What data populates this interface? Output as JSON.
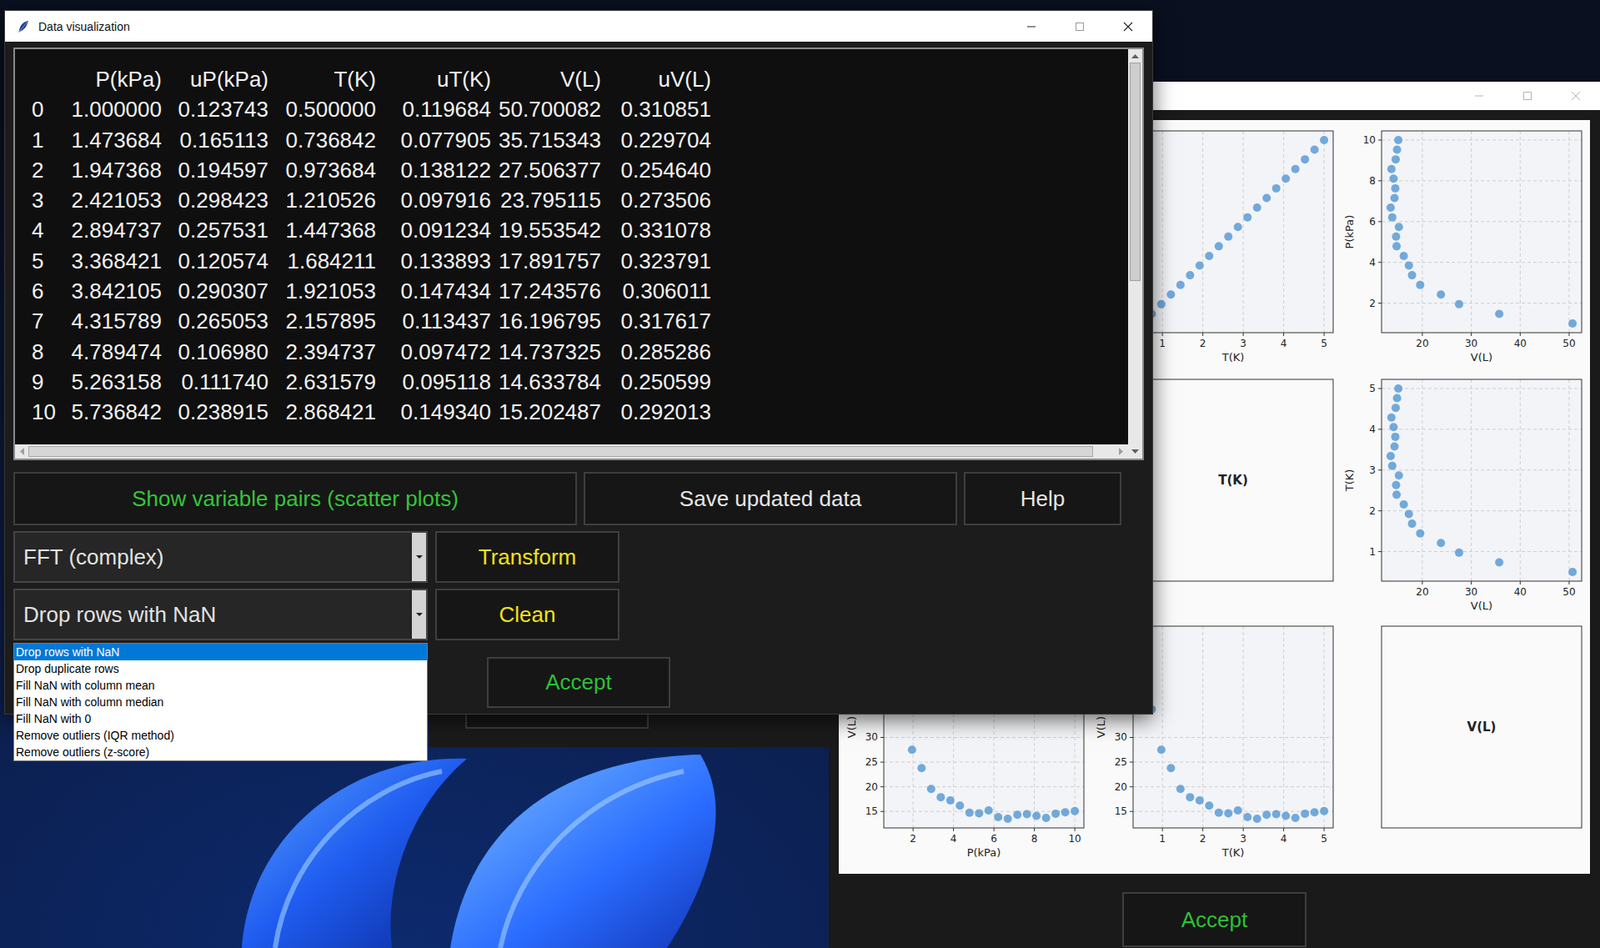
{
  "front_window": {
    "title": "Data visualization",
    "table": {
      "columns": [
        "P(kPa)",
        "uP(kPa)",
        "T(K)",
        "uT(K)",
        "V(L)",
        "uV(L)"
      ],
      "rows": [
        {
          "index": "0",
          "cells": [
            "1.000000",
            "0.123743",
            "0.500000",
            "0.119684",
            "50.700082",
            "0.310851"
          ]
        },
        {
          "index": "1",
          "cells": [
            "1.473684",
            "0.165113",
            "0.736842",
            "0.077905",
            "35.715343",
            "0.229704"
          ]
        },
        {
          "index": "2",
          "cells": [
            "1.947368",
            "0.194597",
            "0.973684",
            "0.138122",
            "27.506377",
            "0.254640"
          ]
        },
        {
          "index": "3",
          "cells": [
            "2.421053",
            "0.298423",
            "1.210526",
            "0.097916",
            "23.795115",
            "0.273506"
          ]
        },
        {
          "index": "4",
          "cells": [
            "2.894737",
            "0.257531",
            "1.447368",
            "0.091234",
            "19.553542",
            "0.331078"
          ]
        },
        {
          "index": "5",
          "cells": [
            "3.368421",
            "0.120574",
            "1.684211",
            "0.133893",
            "17.891757",
            "0.323791"
          ]
        },
        {
          "index": "6",
          "cells": [
            "3.842105",
            "0.290307",
            "1.921053",
            "0.147434",
            "17.243576",
            "0.306011"
          ]
        },
        {
          "index": "7",
          "cells": [
            "4.315789",
            "0.265053",
            "2.157895",
            "0.113437",
            "16.196795",
            "0.317617"
          ]
        },
        {
          "index": "8",
          "cells": [
            "4.789474",
            "0.106980",
            "2.394737",
            "0.097472",
            "14.737325",
            "0.285286"
          ]
        },
        {
          "index": "9",
          "cells": [
            "5.263158",
            "0.111740",
            "2.631579",
            "0.095118",
            "14.633784",
            "0.250599"
          ]
        },
        {
          "index": "10",
          "cells": [
            "5.736842",
            "0.238915",
            "2.868421",
            "0.149340",
            "15.202487",
            "0.292013"
          ]
        }
      ],
      "v_scrollbar": {
        "level": 0.57
      },
      "h_scrollbar": {
        "level": 0.98
      }
    },
    "action_buttons": [
      {
        "label": "Show variable pairs (scatter plots)",
        "color": "#36c43a"
      },
      {
        "label": "Save updated data",
        "color": "#e6e6e6"
      },
      {
        "label": "Help",
        "color": "#e6e6e6"
      }
    ],
    "transform": {
      "value": "FFT (complex)",
      "button": "Transform"
    },
    "clean": {
      "value": "Drop rows with NaN",
      "expanded": true,
      "button": "Clean",
      "options": [
        {
          "label": "Drop rows with NaN",
          "selected": true
        },
        {
          "label": "Drop duplicate rows",
          "selected": false
        },
        {
          "label": "Fill NaN with column mean",
          "selected": false
        },
        {
          "label": "Fill NaN with column median",
          "selected": false
        },
        {
          "label": "Fill NaN with 0",
          "selected": false
        },
        {
          "label": "Remove outliers (IQR method)",
          "selected": false
        },
        {
          "label": "Remove outliers (z-score)",
          "selected": false
        }
      ]
    },
    "accept_button": "Accept"
  },
  "plot_window": {
    "accept_button": "Accept",
    "figure": {
      "rows": [
        [
          {
            "kind": "covered"
          },
          {
            "kind": "scatter",
            "x_label": "T(K)",
            "x_ticks": [
              "1",
              "2",
              "3",
              "4",
              "5"
            ],
            "y_ticks": [],
            "x": [
              0.5,
              0.736842,
              0.973684,
              1.210526,
              1.447368,
              1.684211,
              1.921053,
              2.157895,
              2.394737,
              2.631579,
              2.868421,
              3.105263,
              3.342105,
              3.578947,
              3.815789,
              4.052632,
              4.289474,
              4.526316,
              4.763158,
              5.0
            ],
            "y": [
              1.0,
              1.473684,
              1.947368,
              2.421053,
              2.894737,
              3.368421,
              3.842105,
              4.315789,
              4.789474,
              5.263158,
              5.736842,
              6.210526,
              6.684211,
              7.157895,
              7.631579,
              8.105263,
              8.578947,
              9.052632,
              9.526316,
              10.0
            ]
          },
          {
            "kind": "scatter",
            "x_label": "V(L)",
            "y_label": "P(kPa)",
            "x_ticks": [
              "20",
              "30",
              "40",
              "50"
            ],
            "y_ticks": [
              "2",
              "4",
              "6",
              "8",
              "10"
            ],
            "x": [
              50.700082,
              35.715343,
              27.506377,
              23.795115,
              19.553542,
              17.891757,
              17.243576,
              16.196795,
              14.737325,
              14.633784,
              15.202487,
              13.85,
              13.52,
              14.31,
              14.47,
              14.12,
              13.68,
              14.55,
              14.83,
              15.09
            ],
            "y": [
              1.0,
              1.473684,
              1.947368,
              2.421053,
              2.894737,
              3.368421,
              3.842105,
              4.315789,
              4.789474,
              5.263158,
              5.736842,
              6.210526,
              6.684211,
              7.157895,
              7.631579,
              8.105263,
              8.578947,
              9.052632,
              9.526316,
              10.0
            ]
          }
        ],
        [
          {
            "kind": "covered"
          },
          {
            "kind": "diagonal",
            "label": "T(K)"
          },
          {
            "kind": "scatter",
            "x_label": "V(L)",
            "y_label": "T(K)",
            "x_ticks": [
              "20",
              "30",
              "40",
              "50"
            ],
            "y_ticks": [
              "1",
              "2",
              "3",
              "4",
              "5"
            ],
            "x": [
              50.700082,
              35.715343,
              27.506377,
              23.795115,
              19.553542,
              17.891757,
              17.243576,
              16.196795,
              14.737325,
              14.633784,
              15.202487,
              13.85,
              13.52,
              14.31,
              14.47,
              14.12,
              13.68,
              14.55,
              14.83,
              15.09
            ],
            "y": [
              0.5,
              0.736842,
              0.973684,
              1.210526,
              1.447368,
              1.684211,
              1.921053,
              2.157895,
              2.394737,
              2.631579,
              2.868421,
              3.105263,
              3.342105,
              3.578947,
              3.815789,
              4.052632,
              4.289474,
              4.526316,
              4.763158,
              5.0
            ]
          }
        ],
        [
          {
            "kind": "scatter",
            "x_label": "P(kPa)",
            "y_label": "V(L)",
            "x_ticks": [
              "2",
              "4",
              "6",
              "8",
              "10"
            ],
            "y_ticks": [
              "15",
              "20",
              "25",
              "30"
            ],
            "x": [
              1.0,
              1.473684,
              1.947368,
              2.421053,
              2.894737,
              3.368421,
              3.842105,
              4.315789,
              4.789474,
              5.263158,
              5.736842,
              6.210526,
              6.684211,
              7.157895,
              7.631579,
              8.105263,
              8.578947,
              9.052632,
              9.526316,
              10.0
            ],
            "y": [
              50.700082,
              35.715343,
              27.506377,
              23.795115,
              19.553542,
              17.891757,
              17.243576,
              16.196795,
              14.737325,
              14.633784,
              15.202487,
              13.85,
              13.52,
              14.31,
              14.47,
              14.12,
              13.68,
              14.55,
              14.83,
              15.09
            ]
          },
          {
            "kind": "scatter",
            "x_label": "T(K)",
            "y_label": "V(L)",
            "x_ticks": [
              "1",
              "2",
              "3",
              "4",
              "5"
            ],
            "y_ticks": [
              "15",
              "20",
              "25",
              "30"
            ],
            "x": [
              0.5,
              0.736842,
              0.973684,
              1.210526,
              1.447368,
              1.684211,
              1.921053,
              2.157895,
              2.394737,
              2.631579,
              2.868421,
              3.105263,
              3.342105,
              3.578947,
              3.815789,
              4.052632,
              4.289474,
              4.526316,
              4.763158,
              5.0
            ],
            "y": [
              50.700082,
              35.715343,
              27.506377,
              23.795115,
              19.553542,
              17.891757,
              17.243576,
              16.196795,
              14.737325,
              14.633784,
              15.202487,
              13.85,
              13.52,
              14.31,
              14.47,
              14.12,
              13.68,
              14.55,
              14.83,
              15.09
            ]
          },
          {
            "kind": "diagonal",
            "label": "V(L)"
          }
        ]
      ]
    }
  }
}
